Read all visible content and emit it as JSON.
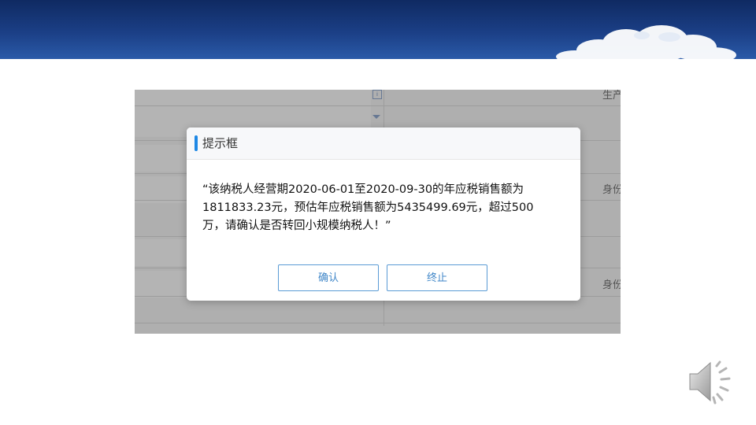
{
  "dialog": {
    "title": "提示框",
    "message_line1": "“该纳税人经营期2020-06-01至2020-09-30的年应税销售额为",
    "message_line2": "1811833.23元，预估年应税销售额为5435499.69元，超过500",
    "message_line3": "万，请确认是否转回小规模纳税人！”",
    "confirm_label": "确认",
    "stop_label": "终止"
  },
  "background_form": {
    "label_top": "生产",
    "label_mid": "身份",
    "label_low": "身份",
    "icon_glyph": "i"
  },
  "colors": {
    "banner": "#1b3f86",
    "accent": "#1e88e5",
    "button_border": "#5a9bd5",
    "button_text": "#3f86c8"
  },
  "icons": {
    "banner_decoration": "cloud-icon",
    "audio": "speaker-icon"
  }
}
